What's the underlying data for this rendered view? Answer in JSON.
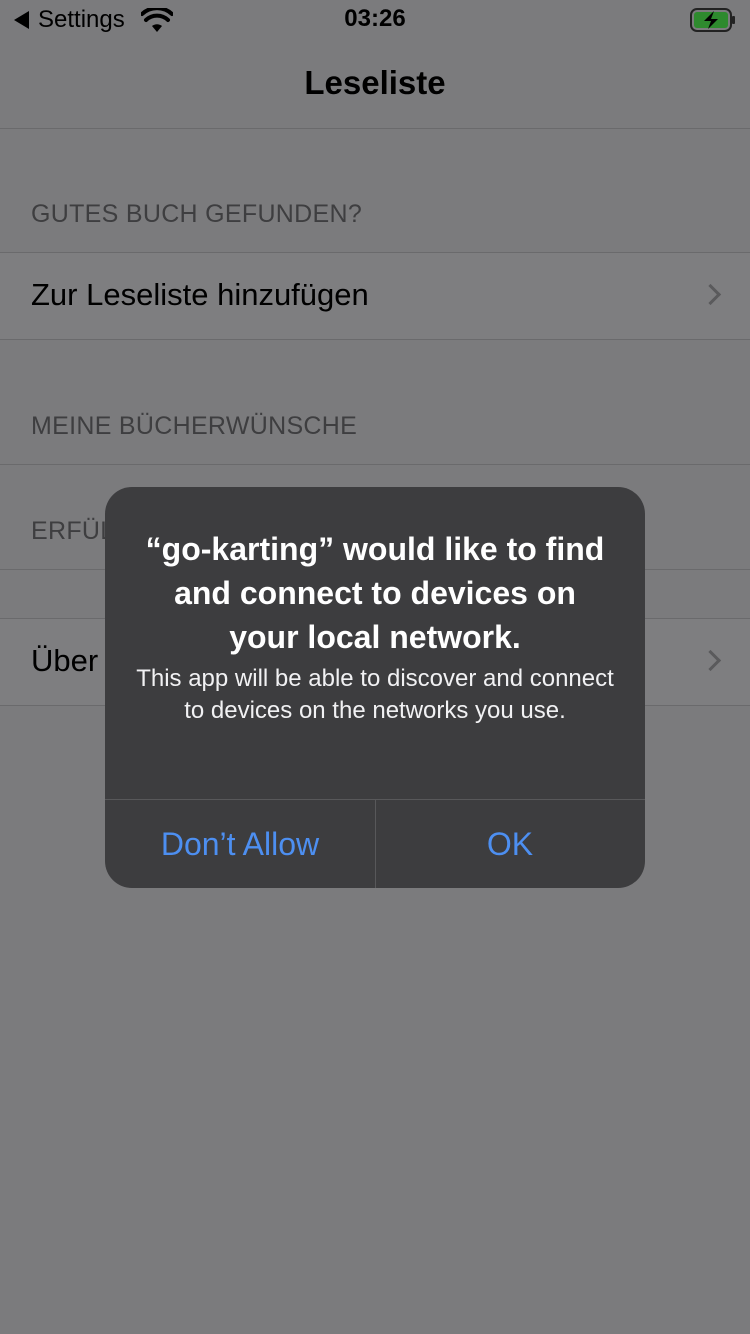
{
  "status_bar": {
    "back_label": "Settings",
    "time": "03:26",
    "icons": [
      "back-triangle-icon",
      "wifi-icon",
      "battery-charging-icon"
    ]
  },
  "nav": {
    "title": "Leseliste"
  },
  "sections": [
    {
      "header": "GUTES BUCH GEFUNDEN?",
      "cell": "Zur Leseliste hinzufügen"
    },
    {
      "header": "MEINE BÜCHERWÜNSCHE"
    },
    {
      "header": "ERFÜL"
    },
    {
      "cell": "Über"
    }
  ],
  "alert": {
    "title": "“go-karting” would like to find and connect to devices on your local network.",
    "message": "This app will be able to discover and connect to devices on the networks you use.",
    "deny_label": "Don’t Allow",
    "ok_label": "OK"
  },
  "colors": {
    "dimmed_background": "#7b7b7d",
    "alert_background": "#3d3d3f",
    "button_blue": "#4d8ff1",
    "battery_green": "#2e8a2e"
  }
}
